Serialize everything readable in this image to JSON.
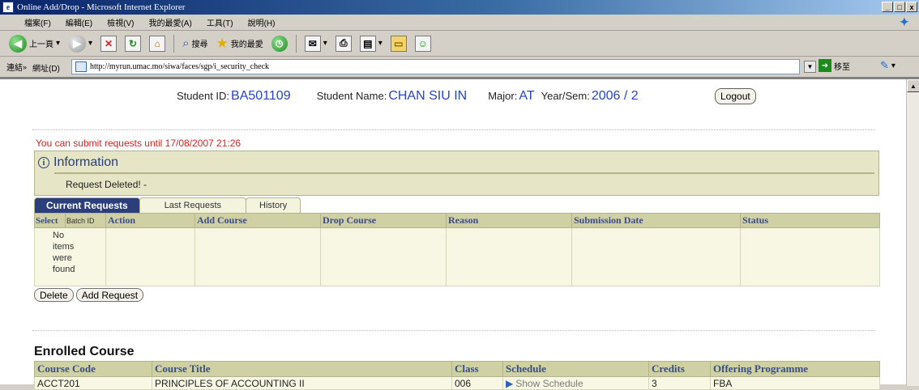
{
  "window": {
    "title": "Online Add/Drop - Microsoft Internet Explorer",
    "buttons": [
      "_",
      "□",
      "x"
    ]
  },
  "menu": [
    "檔案(F)",
    "編輯(E)",
    "檢視(V)",
    "我的最愛(A)",
    "工具(T)",
    "說明(H)"
  ],
  "toolbar": {
    "back_label": "上一頁",
    "search_label": "搜尋",
    "favorites_label": "我的最愛"
  },
  "address": {
    "label": "網址(D)",
    "links_label": "連結",
    "url": "http://myrun.umac.mo/siwa/faces/sgp/i_security_check",
    "go_label": "移至"
  },
  "student": {
    "id_label": "Student ID:",
    "id": "BA501109",
    "name_label": "Student Name:",
    "name": "CHAN SIU IN",
    "major_label": "Major:",
    "major": "AT",
    "term_label": "Year/Sem:",
    "term": "2006 / 2",
    "logout": "Logout"
  },
  "notice": "You can submit requests until 17/08/2007 21:26",
  "information": {
    "title": "Information",
    "message": "Request Deleted! -"
  },
  "tabs": [
    "Current Requests",
    "Last Requests",
    "History"
  ],
  "requests_table": {
    "columns": [
      "Select",
      "Batch ID",
      "Action",
      "Add Course",
      "Drop Course",
      "Reason",
      "Submission Date",
      "Status"
    ],
    "empty_message": "No items were found"
  },
  "buttons": {
    "delete": "Delete",
    "add_request": "Add Request"
  },
  "enrolled": {
    "title": "Enrolled Course",
    "columns": [
      "Course Code",
      "Course Title",
      "Class",
      "Schedule",
      "Credits",
      "Offering Programme"
    ],
    "rows": [
      {
        "code": "ACCT201",
        "title": "PRINCIPLES OF ACCOUNTING II",
        "class": "006",
        "schedule": "Show Schedule",
        "credits": "3",
        "programme": "FBA"
      }
    ]
  }
}
